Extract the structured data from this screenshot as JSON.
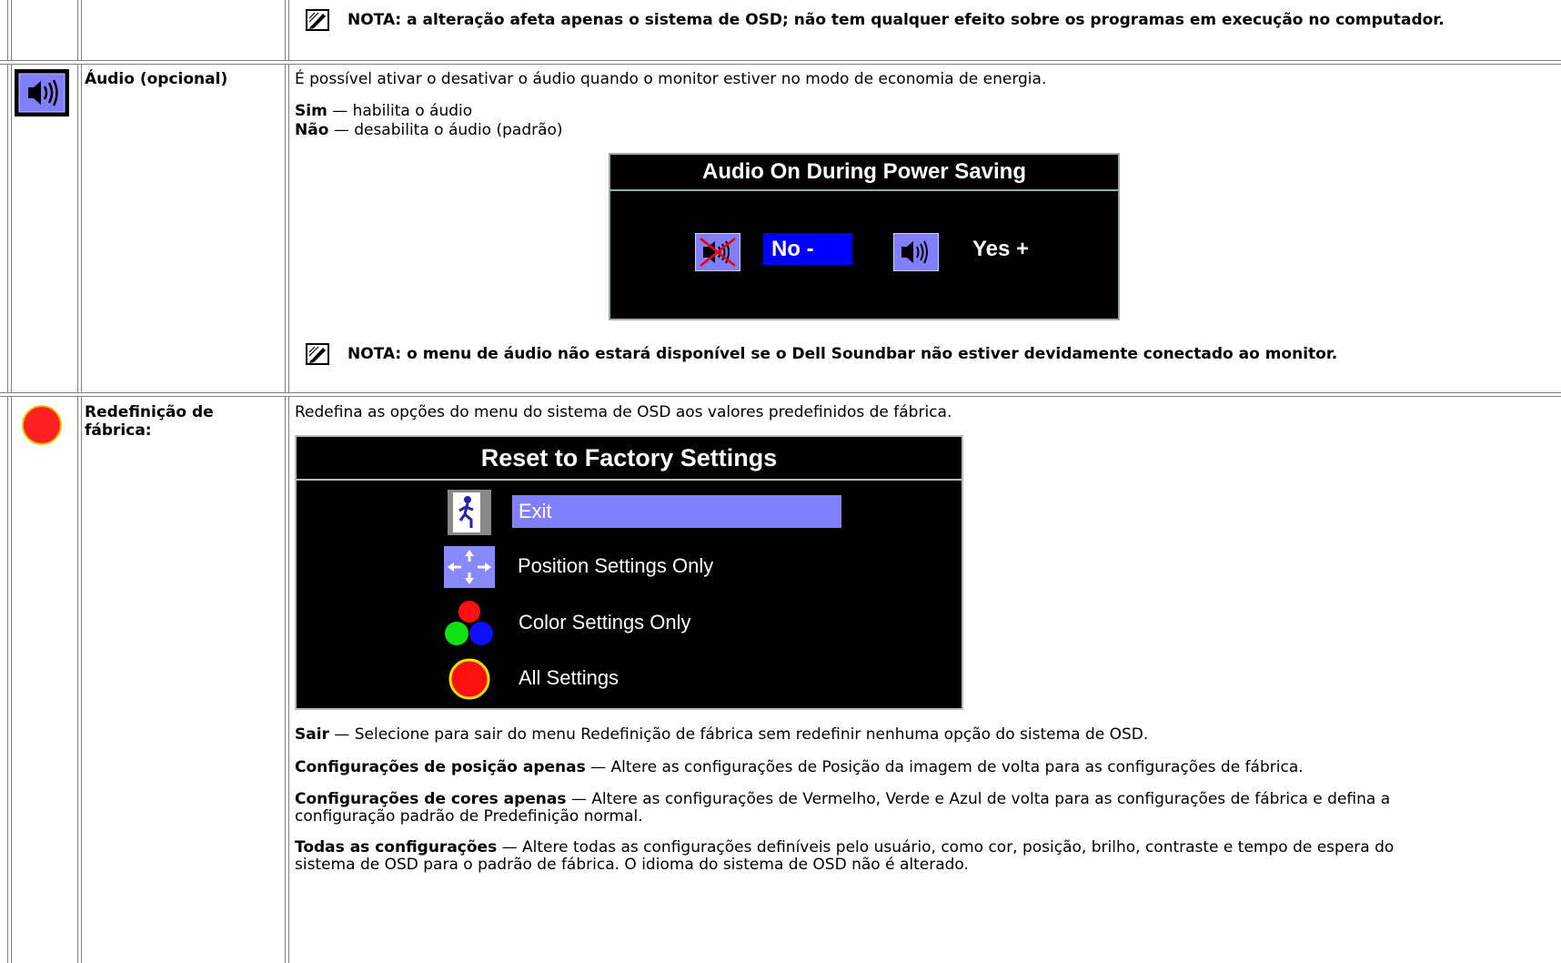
{
  "note1": "NOTA: a alteração afeta apenas o sistema de OSD; não tem qualquer efeito sobre os programas em execução no computador.",
  "audio": {
    "label": "Áudio (opcional)",
    "description": "É possível ativar o desativar o áudio quando o monitor estiver no modo de economia de energia.",
    "sim_term": "Sim",
    "sim_text": " — habilita o áudio",
    "nao_term": "Não",
    "nao_text": " — desabilita o áudio (padrão)",
    "osd": {
      "title": "Audio On During Power Saving",
      "no_label": "No -",
      "yes_label": "Yes +"
    },
    "note": "NOTA: o menu de áudio não estará disponível se o Dell Soundbar não estiver devidamente conectado ao monitor."
  },
  "reset": {
    "label": "Redefinição de fábrica:",
    "description": "Redefina as opções do menu do sistema de OSD aos valores predefinidos de fábrica.",
    "osd": {
      "title": "Reset to Factory Settings",
      "items": [
        "Exit",
        "Position Settings Only",
        "Color Settings Only",
        "All Settings"
      ]
    },
    "defs": [
      {
        "term": "Sair",
        "text": "  — Selecione para sair do menu Redefinição de fábrica sem redefinir nenhuma opção do sistema de OSD."
      },
      {
        "term": "Configurações de posição apenas",
        "text": " — Altere as configurações de Posição da imagem de volta para as configurações de fábrica."
      },
      {
        "term": "Configurações de cores apenas",
        "text": " — Altere as configurações de Vermelho, Verde e Azul de volta para as configurações de fábrica e defina a configuração padrão de Predefinição normal."
      },
      {
        "term": "Todas as configurações",
        "text": " —  Altere todas as configurações definíveis pelo usuário, como cor, posição, brilho, contraste e tempo de espera do sistema de OSD para o padrão de fábrica. O idioma do sistema de OSD não é alterado."
      }
    ]
  },
  "colors": {
    "osd_bg": "#000000",
    "highlight_blue": "#0000ff",
    "highlight_lavender": "#7f7fff",
    "reset_red": "#ff0000"
  }
}
